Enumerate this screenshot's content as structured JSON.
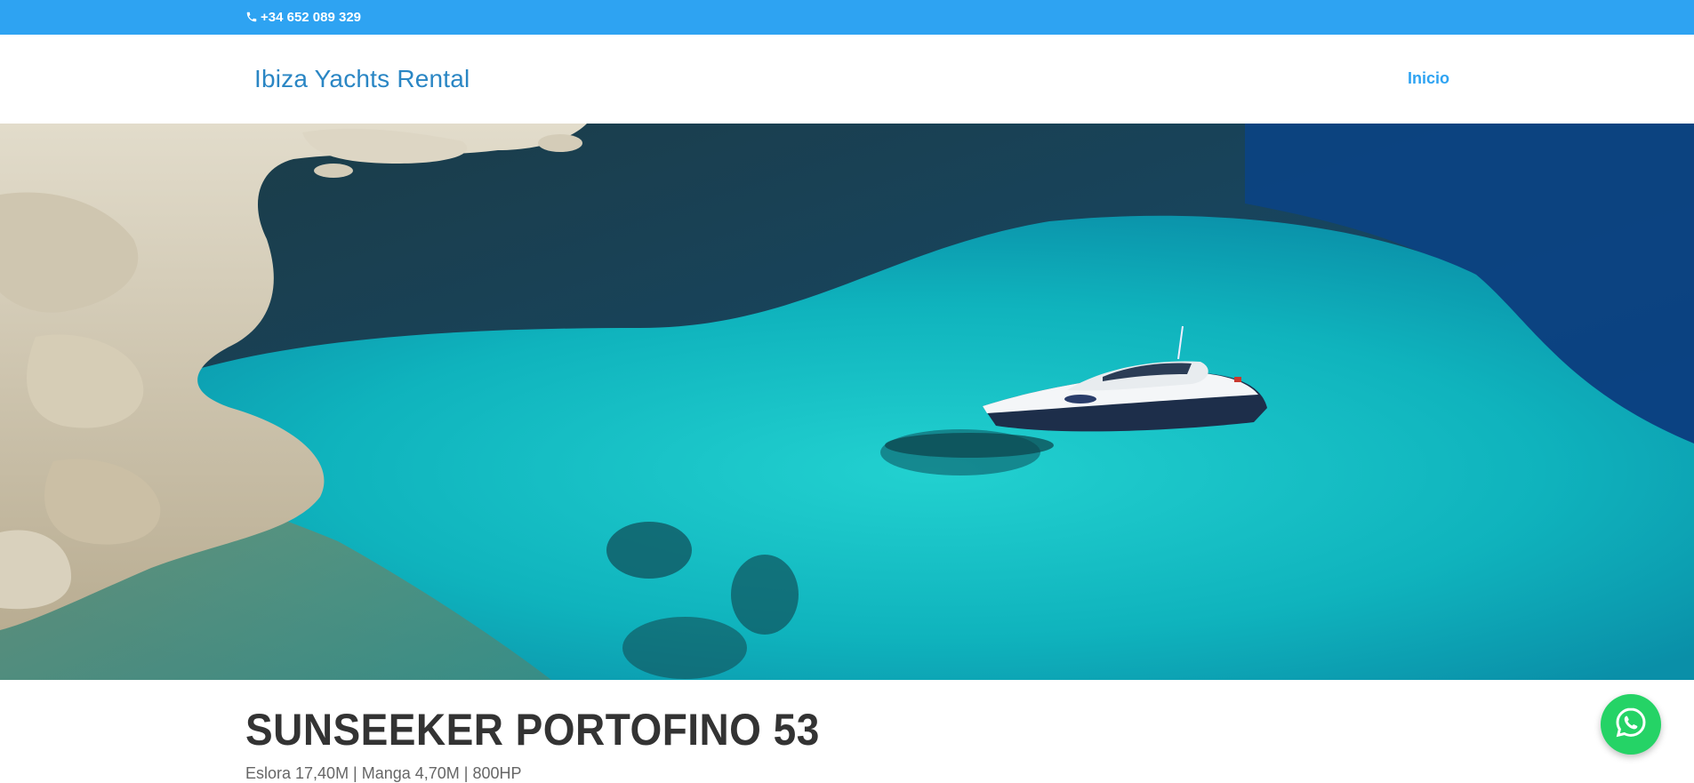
{
  "topbar": {
    "phone": "+34 652 089 329",
    "icon": "phone-icon",
    "background": "#2ea3f2"
  },
  "header": {
    "logo": "Ibiza Yachts Rental",
    "nav": [
      {
        "label": "Inicio"
      }
    ],
    "accent": "#2ea3f2"
  },
  "hero": {
    "image": "aerial view of a white motor yacht anchored in turquoise water beside rocky cliffs",
    "slides_total": 4,
    "active_slide": 2
  },
  "yacht": {
    "title": "SUNSEEKER PORTOFINO 53",
    "specs": "Eslora 17,40M | Manga 4,70M | 800HP"
  },
  "floating": {
    "icon": "whatsapp-icon",
    "color": "#25d366"
  }
}
